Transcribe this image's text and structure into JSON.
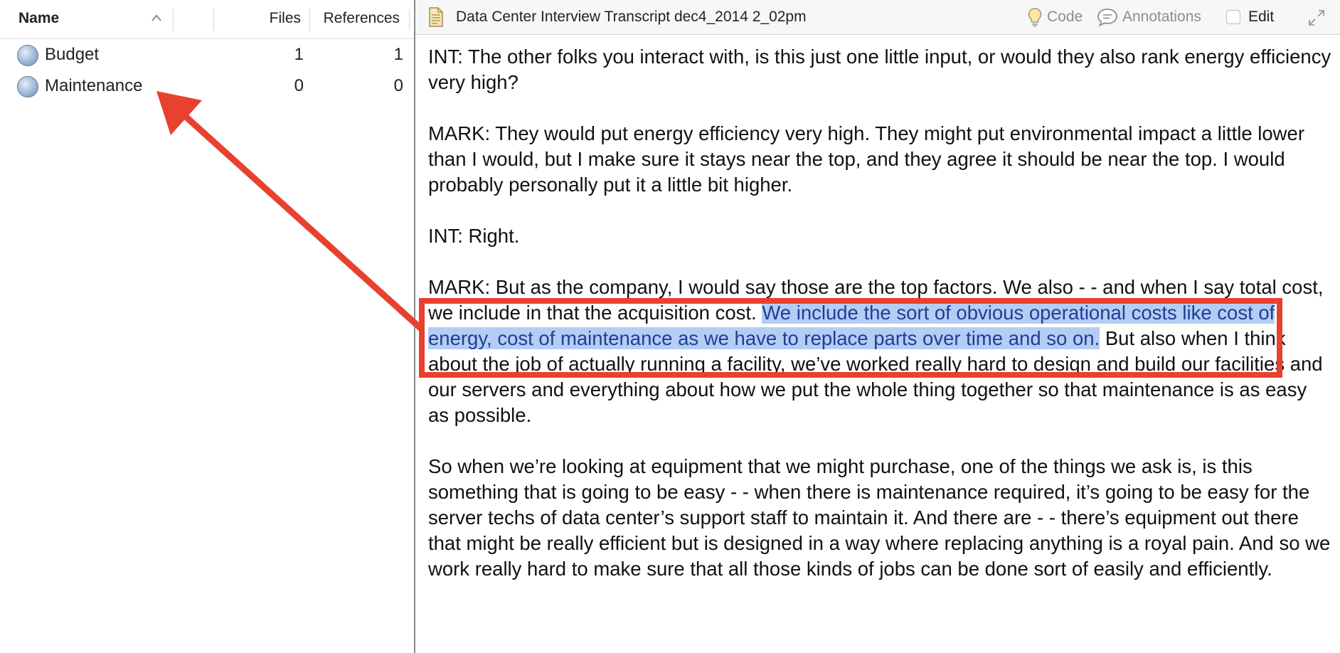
{
  "codes_panel": {
    "columns": {
      "name": "Name",
      "files": "Files",
      "references": "References"
    },
    "rows": [
      {
        "name": "Budget",
        "files": "1",
        "references": "1"
      },
      {
        "name": "Maintenance",
        "files": "0",
        "references": "0"
      }
    ]
  },
  "document": {
    "title": "Data Center Interview Transcript dec4_2014 2_02pm",
    "toolbar": {
      "code_label": "Code",
      "annotations_label": "Annotations",
      "edit_label": "Edit"
    },
    "paragraphs": [
      {
        "text": "INT:  The other folks you interact with, is this just one little input, or would they also rank energy efficiency very high?"
      },
      {
        "text": "MARK:  They would put energy efficiency very high.  They might put environmental impact a little lower than I would, but I make sure it stays near the top, and they agree it should be near the top.  I would probably personally put it a little bit higher."
      },
      {
        "text": "INT:  Right."
      },
      {
        "before": "MARK:  But as the company, I would say those are the top factors.  We also - - and when I say total cost, we include in that the acquisition cost.  ",
        "highlighted": "We include the sort of obvious operational costs like cost of energy, cost of maintenance as we have to replace parts over time and so on.",
        "after": "  But also when I think about the job of actually running a facility, we’ve worked really hard to design and build our facilities and our servers and everything about how we put the whole thing together so that maintenance is as easy as possible."
      },
      {
        "text": "So when we’re looking at equipment that we might purchase, one of the things we ask is, is this something that is going to be easy - - when there is maintenance required, it’s going to be easy for the server techs of data center’s support staff to maintain it.  And there are - - there’s equipment out there that might be really efficient but is designed in a way where replacing anything is a royal pain.  And so we work really hard to make sure that all those kinds of jobs can be done sort of easily and efficiently."
      }
    ]
  },
  "annotation": {
    "arrow_color": "#e8412f",
    "box_color": "#e8412f",
    "highlight_color": "#b5cdf5"
  }
}
